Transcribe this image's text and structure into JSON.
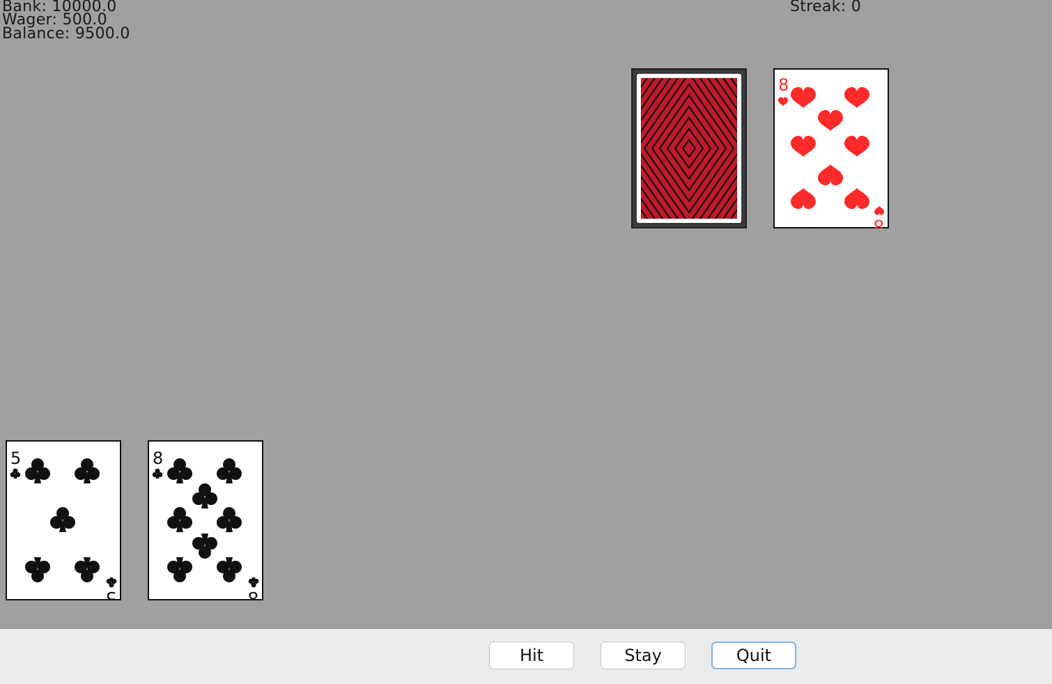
{
  "status": {
    "bank": "Bank: 10000.0",
    "wager": "Wager: 500.0",
    "balance": "Balance: 9500.0",
    "streak": "Streak: 0"
  },
  "dealer": {
    "cards": [
      {
        "face_down": true,
        "back_color": "#c0192b"
      },
      {
        "face_down": false,
        "rank": "8",
        "suit": "hearts",
        "color": "#ff2a2a"
      }
    ]
  },
  "player": {
    "cards": [
      {
        "face_down": false,
        "rank": "5",
        "suit": "clubs",
        "color": "#111111"
      },
      {
        "face_down": false,
        "rank": "8",
        "suit": "clubs",
        "color": "#111111"
      }
    ]
  },
  "controls": {
    "hit_label": "Hit",
    "stay_label": "Stay",
    "quit_label": "Quit"
  },
  "colors": {
    "table": "#a0a0a0",
    "bar": "#ececec",
    "focus_ring": "#7fb1e6"
  }
}
